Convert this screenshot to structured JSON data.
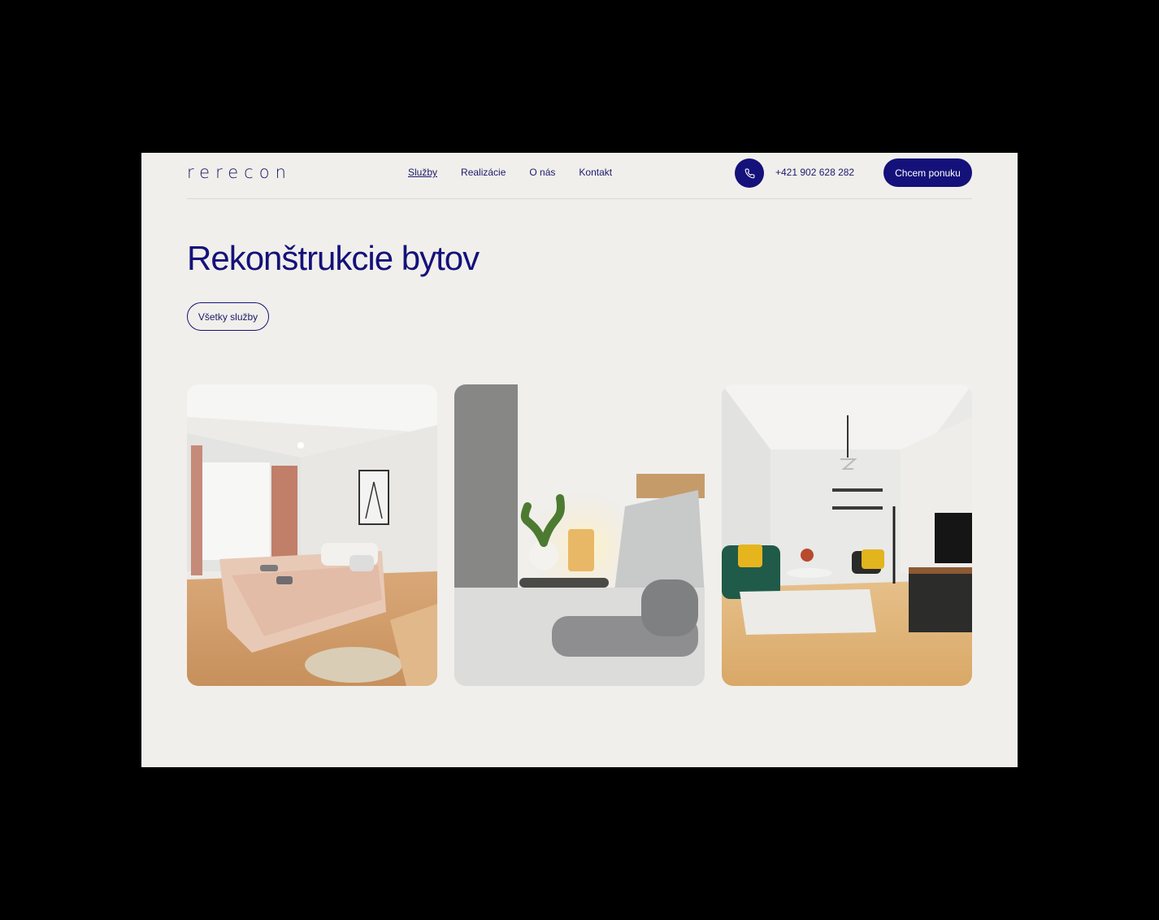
{
  "brand": {
    "logo": "rerecon"
  },
  "nav": {
    "items": [
      "Služby",
      "Realizácie",
      "O nás",
      "Kontakt"
    ],
    "active": "Služby"
  },
  "contact": {
    "phone": "+421 902 628 282"
  },
  "header": {
    "cta_label": "Chcem ponuku"
  },
  "hero": {
    "title": "Rekonštrukcie bytov",
    "all_services_label": "Všetky služby"
  },
  "colors": {
    "accent": "#14117a",
    "background": "#f1efeb"
  },
  "icons": {
    "phone": "phone-icon"
  }
}
